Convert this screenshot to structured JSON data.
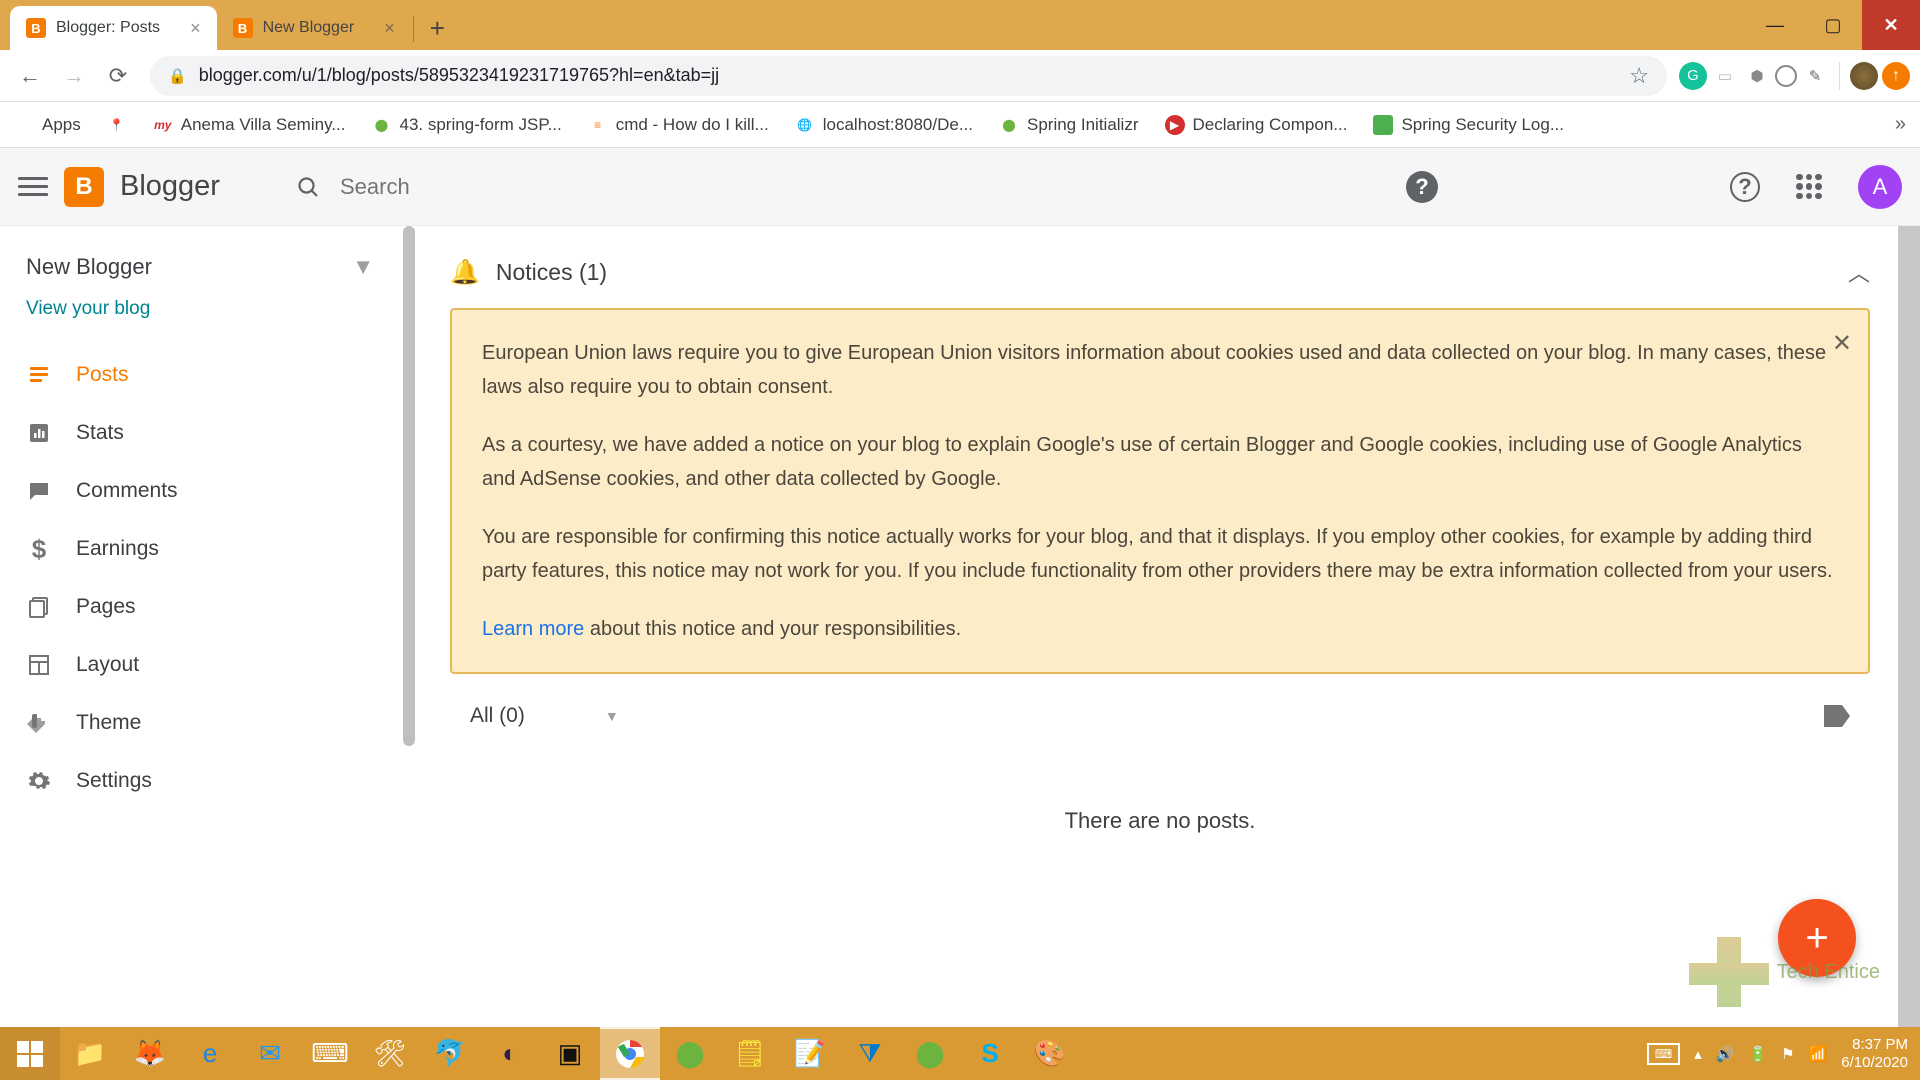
{
  "browser": {
    "tabs": [
      {
        "title": "Blogger: Posts",
        "active": true
      },
      {
        "title": "New Blogger",
        "active": false
      }
    ],
    "url": "blogger.com/u/1/blog/posts/5895323419231719765?hl=en&tab=jj",
    "bookmarks": [
      {
        "label": "Apps",
        "icon": "apps"
      },
      {
        "label": "",
        "icon": "pin-red"
      },
      {
        "label": "Anema Villa Seminy...",
        "icon": "my"
      },
      {
        "label": "43. spring-form JSP...",
        "icon": "spring"
      },
      {
        "label": "cmd - How do I kill...",
        "icon": "stack"
      },
      {
        "label": "localhost:8080/De...",
        "icon": "globe"
      },
      {
        "label": "Spring Initializr",
        "icon": "spring"
      },
      {
        "label": "Declaring Compon...",
        "icon": "red-play"
      },
      {
        "label": "Spring Security Log...",
        "icon": "green-sq"
      }
    ]
  },
  "header": {
    "brand": "Blogger",
    "search_placeholder": "Search",
    "avatar_letter": "A"
  },
  "sidebar": {
    "blog_name": "New Blogger",
    "view_link": "View your blog",
    "items": [
      {
        "label": "Posts",
        "icon": "posts",
        "active": true
      },
      {
        "label": "Stats",
        "icon": "stats",
        "active": false
      },
      {
        "label": "Comments",
        "icon": "comments",
        "active": false
      },
      {
        "label": "Earnings",
        "icon": "earnings",
        "active": false
      },
      {
        "label": "Pages",
        "icon": "pages",
        "active": false
      },
      {
        "label": "Layout",
        "icon": "layout",
        "active": false
      },
      {
        "label": "Theme",
        "icon": "theme",
        "active": false
      },
      {
        "label": "Settings",
        "icon": "settings",
        "active": false
      }
    ]
  },
  "main": {
    "notices_title": "Notices (1)",
    "notice": {
      "p1": "European Union laws require you to give European Union visitors information about cookies used and data collected on your blog. In many cases, these laws also require you to obtain consent.",
      "p2": "As a courtesy, we have added a notice on your blog to explain Google's use of certain Blogger and Google cookies, including use of Google Analytics and AdSense cookies, and other data collected by Google.",
      "p3": "You are responsible for confirming this notice actually works for your blog, and that it displays. If you employ other cookies, for example by adding third party features, this notice may not work for you. If you include functionality from other providers there may be extra information collected from your users.",
      "learn_more": "Learn more",
      "learn_more_tail": " about this notice and your responsibilities."
    },
    "filter_label": "All (0)",
    "empty_text": "There are no posts."
  },
  "watermark": "Tech Entice",
  "taskbar": {
    "time": "8:37 PM",
    "date": "6/10/2020"
  }
}
